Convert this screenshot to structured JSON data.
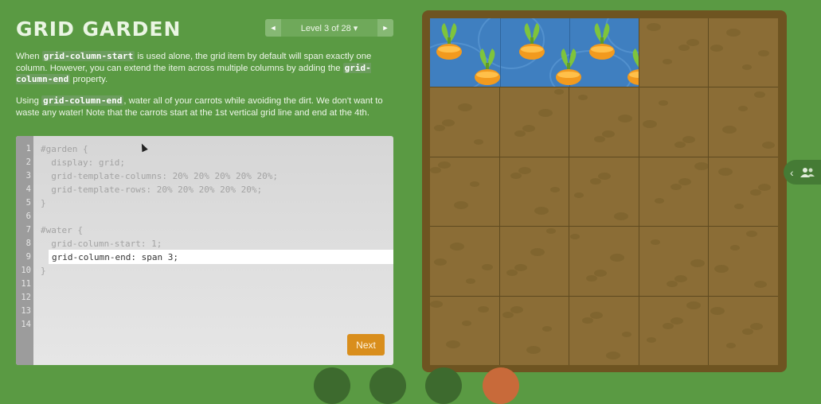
{
  "title": "GRID GARDEN",
  "level_nav": {
    "prev_icon": "◄",
    "label": "Level 3 of 28 ▾",
    "next_icon": "►"
  },
  "instructions": {
    "p1_a": "When ",
    "p1_code1": "grid-column-start",
    "p1_b": " is used alone, the grid item by default will span exactly one column. However, you can extend the item across multiple columns by adding the ",
    "p1_code2": "grid-column-end",
    "p1_c": " property.",
    "p2_a": "Using ",
    "p2_code": "grid-column-end",
    "p2_b": ", water all of your carrots while avoiding the dirt. We don't want to waste any water! Note that the carrots start at the 1st vertical grid line and end at the 4th."
  },
  "editor": {
    "line_numbers": [
      "1",
      "2",
      "3",
      "4",
      "5",
      "6",
      "7",
      "8",
      "9",
      "10",
      "11",
      "12",
      "13",
      "14"
    ],
    "lines": [
      "#garden {",
      "  display: grid;",
      "  grid-template-columns: 20% 20% 20% 20% 20%;",
      "  grid-template-rows: 20% 20% 20% 20% 20%;",
      "}",
      "",
      "#water {",
      "  grid-column-start: 1;",
      "",
      "}"
    ],
    "input_value": "grid-column-end: span 3;",
    "next_label": "Next"
  },
  "garden": {
    "columns": 5,
    "rows": 5,
    "water_span_columns": 3,
    "carrot_count": 6,
    "colors": {
      "soil": "#8b6d36",
      "frame": "#6e5421",
      "water": "#3f7fc0",
      "carrot": "#f29a1e",
      "leaf": "#7ec43c"
    }
  },
  "side_widget": {
    "chevron_icon": "‹",
    "people_icon": "people-icon"
  }
}
